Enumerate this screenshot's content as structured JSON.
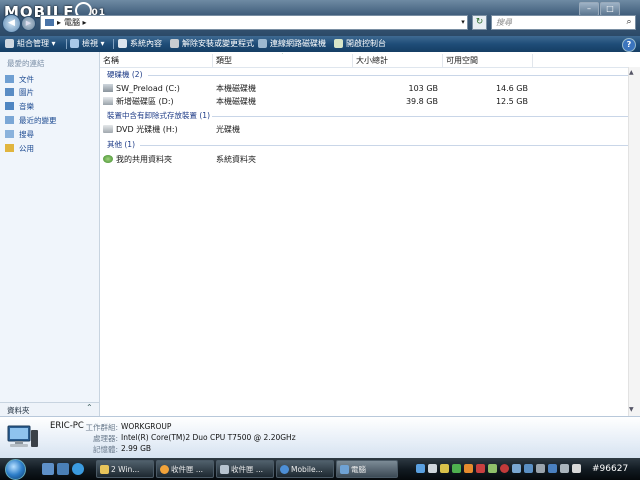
{
  "brand": {
    "logo_text": "MOBILE",
    "logo_suffix": "01"
  },
  "window": {
    "min": "–",
    "max": "□",
    "close": "✕"
  },
  "address": {
    "path": "電腦 ▸",
    "root_arrow": "▸"
  },
  "search": {
    "placeholder": "搜尋"
  },
  "toolbar": {
    "organize": "組合管理 ▾",
    "views": "檢視 ▾",
    "system_properties": "系統內容",
    "uninstall": "解除安裝或變更程式",
    "map_drive": "連線網路磁碟機",
    "control_panel": "開啟控制台",
    "more": "»"
  },
  "nav": {
    "favorites_title": "最愛的連結",
    "items": [
      "文件",
      "圖片",
      "音樂",
      "最近的變更",
      "搜尋",
      "公用"
    ],
    "folders": "資料夾"
  },
  "columns": [
    "名稱",
    "類型",
    "大小總計",
    "可用空間"
  ],
  "groups": [
    {
      "label": "硬碟機 (2)",
      "items": [
        {
          "name": "SW_Preload (C:)",
          "type": "本機磁碟機",
          "total": "103 GB",
          "free": "14.6 GB"
        },
        {
          "name": "新增磁碟區 (D:)",
          "type": "本機磁碟機",
          "total": "39.8 GB",
          "free": "12.5 GB"
        }
      ]
    },
    {
      "label": "裝置中含有卸除式存放裝置 (1)",
      "items": [
        {
          "name": "DVD 光碟機 (H:)",
          "type": "光碟機",
          "total": "",
          "free": ""
        }
      ]
    },
    {
      "label": "其他 (1)",
      "items": [
        {
          "name": "我的共用資料夾",
          "type": "系統資料夾",
          "total": "",
          "free": ""
        }
      ]
    }
  ],
  "details": {
    "pc_name": "ERIC-PC",
    "workgroup_label": "工作群組:",
    "workgroup": "WORKGROUP",
    "cpu_label": "處理器:",
    "cpu": "Intel(R) Core(TM)2 Duo CPU    T7500  @ 2.20GHz",
    "mem_label": "記憶體:",
    "mem": "2.99 GB"
  },
  "taskbar": {
    "tasks": [
      "2 Win...",
      "收件匣 ...",
      "收件匣 ...",
      "Mobile...",
      "電腦"
    ],
    "watermark": "#96627"
  },
  "colors": {
    "toolbar": "#1f4d78",
    "link": "#1c4a91",
    "group": "#1c3a86"
  }
}
